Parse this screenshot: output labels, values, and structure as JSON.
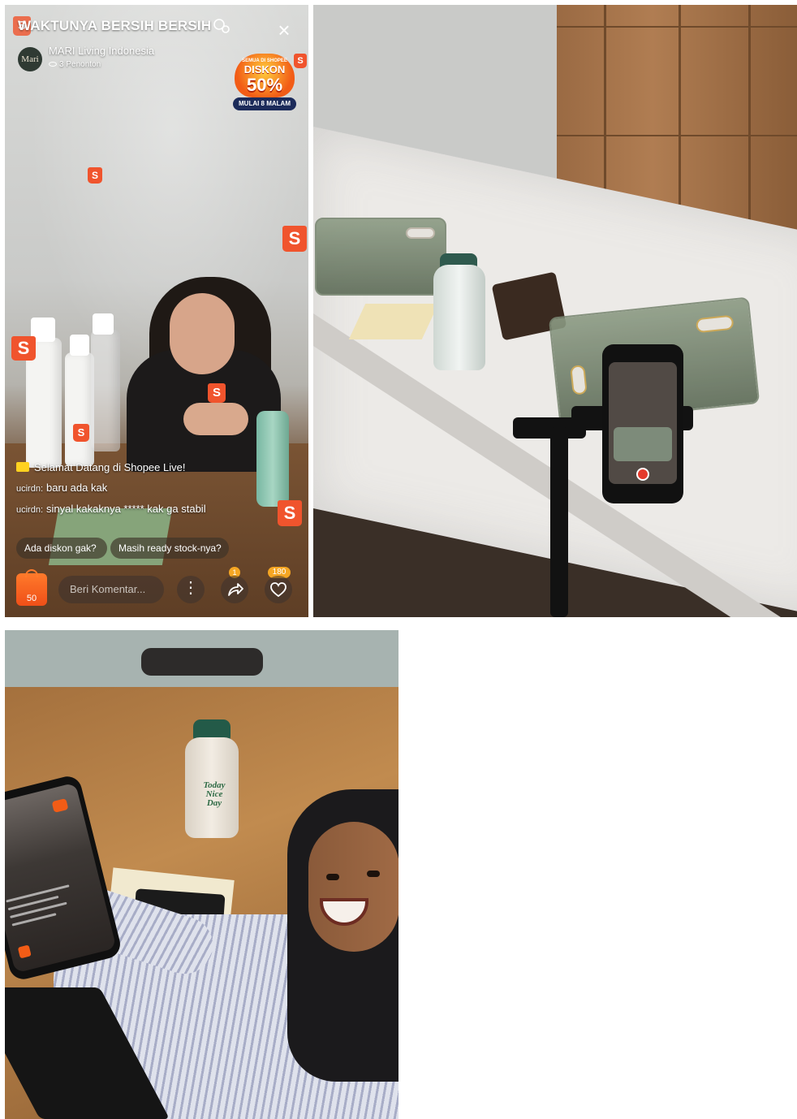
{
  "live": {
    "title": "WAKTUNYA BERSIH BERSIH",
    "channel": "MARI Living Indonesia",
    "avatar_text": "Mari",
    "viewers": "3 Penonton",
    "promo": {
      "top": "SEMUA DI SHOPEE",
      "label": "DISKON",
      "percent": "50%",
      "time": "MULAI 8 MALAM"
    },
    "welcome": "Selamat Datang di Shopee Live!",
    "comments": [
      {
        "user": "ucirdn:",
        "text": "baru ada kak"
      },
      {
        "user": "ucirdn:",
        "text": "sinyal kakaknya ***** kak ga stabil"
      }
    ],
    "quick_replies": [
      "Ada diskon gak?",
      "Masih ready stock-nya?"
    ],
    "bag_count": "50",
    "comment_placeholder": "Beri Komentar...",
    "share_count": "1",
    "like_count": "180",
    "float_icon": "S"
  },
  "bottle_print": "Today Nice Day",
  "colors": {
    "shopee_orange": "#f0542d",
    "badge_yellow": "#f5a623",
    "promo_navy": "#1c2b5a"
  },
  "icons": [
    "close-icon",
    "eye-icon",
    "speaker-icon",
    "shopping-bag-icon",
    "more-icon",
    "share-icon",
    "heart-icon",
    "shopee-bag-icon"
  ]
}
